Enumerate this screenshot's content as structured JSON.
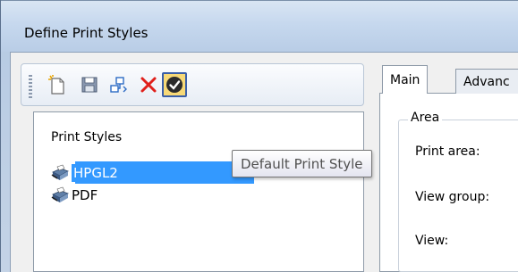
{
  "window": {
    "title": "Define Print Styles"
  },
  "toolbar": {
    "buttons": [
      {
        "icon": "new-document-icon"
      },
      {
        "icon": "save-icon"
      },
      {
        "icon": "rename-icon"
      },
      {
        "icon": "delete-icon"
      },
      {
        "icon": "set-default-icon"
      }
    ]
  },
  "tooltip": {
    "text": "Default Print Style"
  },
  "print_styles": {
    "header": "Print Styles",
    "items": [
      {
        "label": "HPGL2",
        "selected": true
      },
      {
        "label": "PDF",
        "selected": false
      }
    ]
  },
  "tabs": [
    {
      "label": "Main",
      "active": true
    },
    {
      "label": "Advanc",
      "active": false
    }
  ],
  "main_tab": {
    "group_title": "Area",
    "fields": [
      {
        "label": "Print area:"
      },
      {
        "label": "View group:"
      },
      {
        "label": "View:"
      }
    ]
  },
  "colors": {
    "selection": "#3399ff",
    "delete": "#e0201b",
    "pressed_button": "#f7d977"
  }
}
